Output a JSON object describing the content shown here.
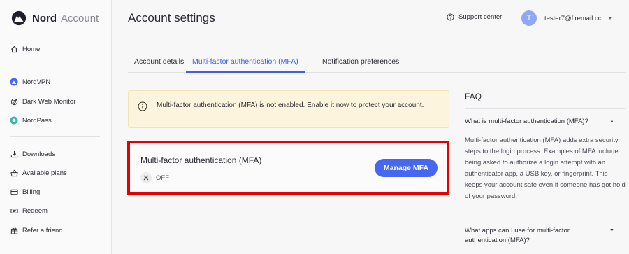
{
  "brand": {
    "name": "Nord",
    "suffix": "Account"
  },
  "sidebar": {
    "items": [
      {
        "label": "Home",
        "icon": "home-icon"
      },
      {
        "label": "NordVPN",
        "icon": "nordvpn-icon"
      },
      {
        "label": "Dark Web Monitor",
        "icon": "dark-web-monitor-icon"
      },
      {
        "label": "NordPass",
        "icon": "nordpass-icon"
      },
      {
        "label": "Downloads",
        "icon": "download-icon"
      },
      {
        "label": "Available plans",
        "icon": "basket-icon"
      },
      {
        "label": "Billing",
        "icon": "card-icon"
      },
      {
        "label": "Redeem",
        "icon": "ticket-icon"
      },
      {
        "label": "Refer a friend",
        "icon": "gift-icon"
      }
    ]
  },
  "header": {
    "title": "Account settings",
    "support_label": "Support center",
    "user": {
      "initial": "T",
      "email": "tester7@firemail.cc"
    }
  },
  "tabs": [
    {
      "label": "Account details",
      "active": false
    },
    {
      "label": "Multi-factor authentication (MFA)",
      "active": true
    },
    {
      "label": "Notification preferences",
      "active": false
    }
  ],
  "banner": {
    "text": "Multi-factor authentication (MFA) is not enabled. Enable it now to protect your account."
  },
  "mfa_card": {
    "title": "Multi-factor authentication (MFA)",
    "status": "OFF",
    "button_label": "Manage MFA"
  },
  "faq": {
    "title": "FAQ",
    "questions": [
      {
        "question": "What is multi-factor authentication (MFA)?",
        "expanded": true,
        "answer": "Multi-factor authentication (MFA) adds extra security steps to the login process. Examples of MFA include being asked to authorize a login attempt with an authenticator app, a USB key, or fingerprint. This keeps your account safe even if someone has got hold of your password."
      },
      {
        "question": "What apps can I use for multi-factor authentication (MFA)?",
        "expanded": false
      }
    ]
  },
  "colors": {
    "accent": "#3e5fe6",
    "button": "#4767f0",
    "highlight": "#e60000",
    "banner_bg": "#fdf4dd",
    "avatar": "#8fa8f3"
  }
}
